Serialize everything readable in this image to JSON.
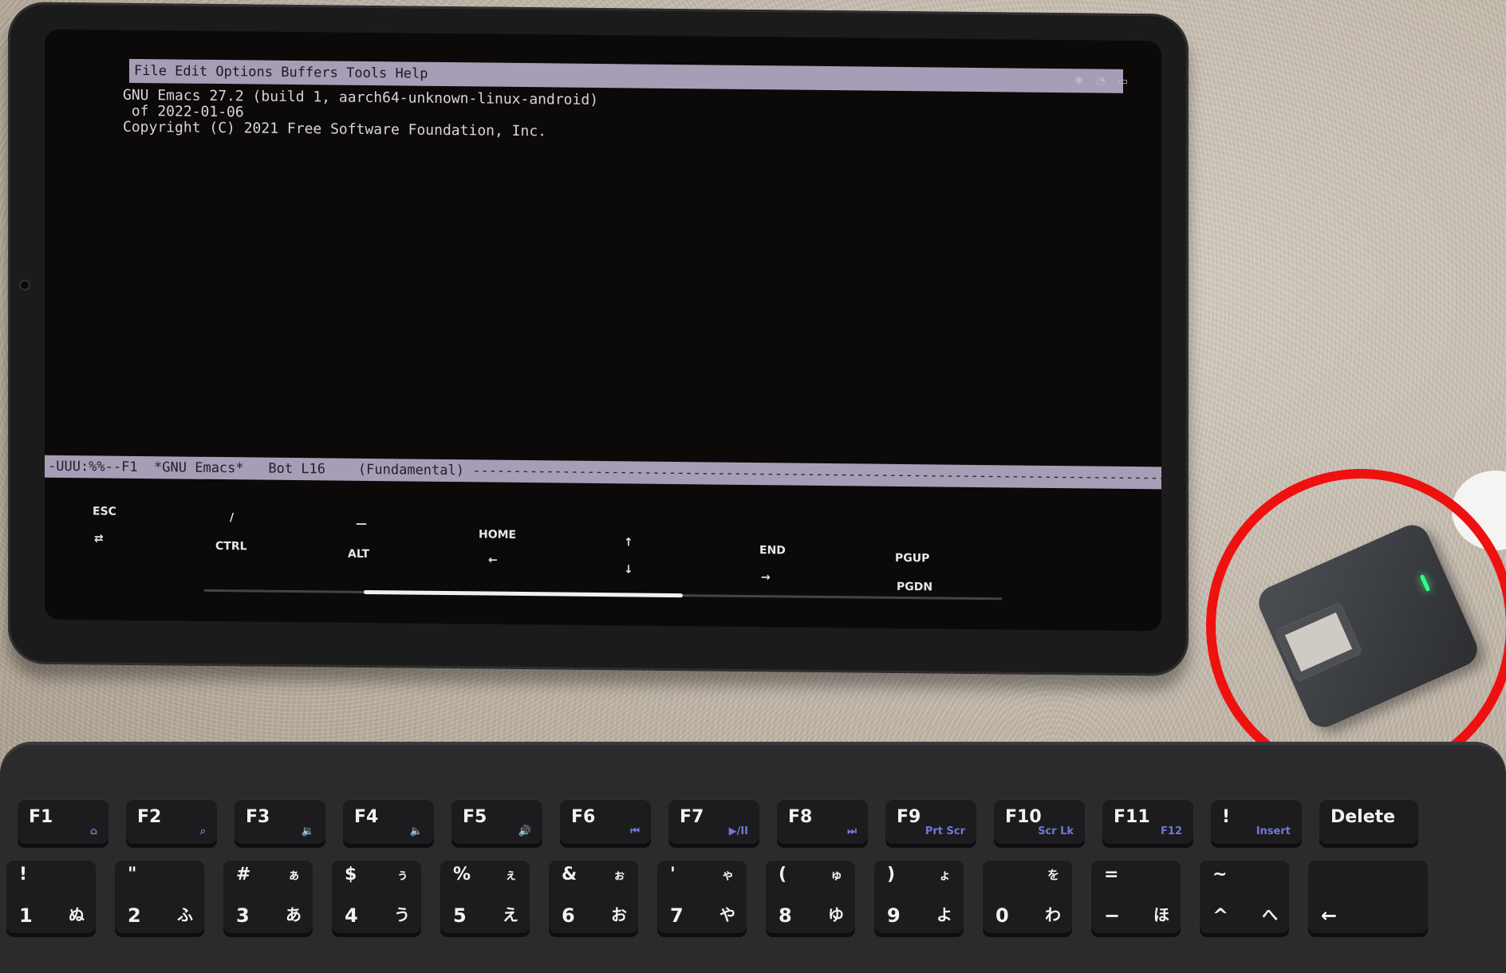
{
  "emacs": {
    "menubar": "File Edit Options Buffers Tools Help",
    "lines": [
      "GNU Emacs 27.2 (build 1, aarch64-unknown-linux-android)",
      " of 2022-01-06",
      "Copyright (C) 2021 Free Software Foundation, Inc."
    ],
    "modeline": "-UUU:%%--F1  *GNU Emacs*   Bot L16    (Fundamental) -------------------------------------------------------------------------------------"
  },
  "extra_keys": {
    "esc": "ESC",
    "tab": "⇄",
    "slash": "/",
    "ctrl": "CTRL",
    "dash": "—",
    "alt": "ALT",
    "home": "HOME",
    "left": "←",
    "up": "↑",
    "down": "↓",
    "end": "END",
    "right": "→",
    "pgup": "PGUP",
    "pgdn": "PGDN"
  },
  "keyboard": {
    "fn_row": [
      {
        "main": "F1",
        "sub": "⌂"
      },
      {
        "main": "F2",
        "sub": "⌕"
      },
      {
        "main": "F3",
        "sub": "🔉"
      },
      {
        "main": "F4",
        "sub": "🔈"
      },
      {
        "main": "F5",
        "sub": "🔊"
      },
      {
        "main": "F6",
        "sub": "⏮"
      },
      {
        "main": "F7",
        "sub": "▶/II"
      },
      {
        "main": "F8",
        "sub": "⏭"
      },
      {
        "main": "F9",
        "sub": "Prt Scr"
      },
      {
        "main": "F10",
        "sub": "Scr Lk"
      },
      {
        "main": "F11",
        "sub": "F12"
      },
      {
        "main": "!",
        "sub": "Insert"
      },
      {
        "main": "Delete",
        "sub": ""
      }
    ],
    "num_row": [
      {
        "top": "!",
        "bottom": "1",
        "kana1": "",
        "kana2": "ぬ"
      },
      {
        "top": "\"",
        "bottom": "2",
        "kana1": "",
        "kana2": "ふ"
      },
      {
        "top": "#",
        "bottom": "3",
        "kana1": "ぁ",
        "kana2": "あ"
      },
      {
        "top": "$",
        "bottom": "4",
        "kana1": "ぅ",
        "kana2": "う"
      },
      {
        "top": "%",
        "bottom": "5",
        "kana1": "ぇ",
        "kana2": "え"
      },
      {
        "top": "&",
        "bottom": "6",
        "kana1": "ぉ",
        "kana2": "お"
      },
      {
        "top": "'",
        "bottom": "7",
        "kana1": "ゃ",
        "kana2": "や"
      },
      {
        "top": "(",
        "bottom": "8",
        "kana1": "ゅ",
        "kana2": "ゆ"
      },
      {
        "top": ")",
        "bottom": "9",
        "kana1": "ょ",
        "kana2": "よ"
      },
      {
        "top": "",
        "bottom": "0",
        "kana1": "を",
        "kana2": "わ"
      },
      {
        "top": "=",
        "bottom": "−",
        "kana1": "",
        "kana2": "ほ"
      },
      {
        "top": "~",
        "bottom": "^",
        "kana1": "",
        "kana2": "へ"
      },
      {
        "top": "",
        "bottom": "←",
        "kana1": "",
        "kana2": ""
      }
    ]
  },
  "colors": {
    "annotation_circle": "#ef1010",
    "dongle_led": "#31ff85"
  }
}
